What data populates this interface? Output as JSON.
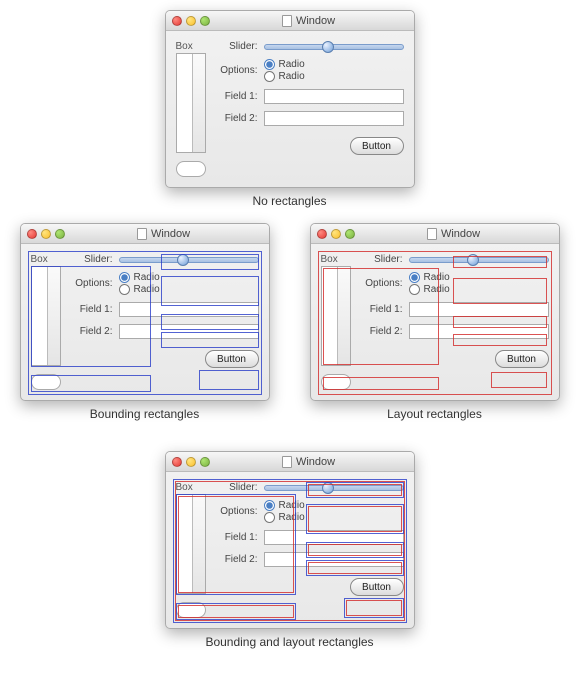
{
  "window_title": "Window",
  "box": {
    "label": "Box"
  },
  "slider": {
    "label": "Slider:"
  },
  "options": {
    "label": "Options:",
    "radio1": "Radio",
    "radio2": "Radio"
  },
  "fields": {
    "f1_label": "Field 1:",
    "f2_label": "Field 2:"
  },
  "button": {
    "label": "Button"
  },
  "search": {
    "placeholder": ""
  },
  "captions": {
    "none": "No rectangles",
    "bounding": "Bounding rectangles",
    "layout": "Layout rectangles",
    "both": "Bounding and layout rectangles"
  }
}
